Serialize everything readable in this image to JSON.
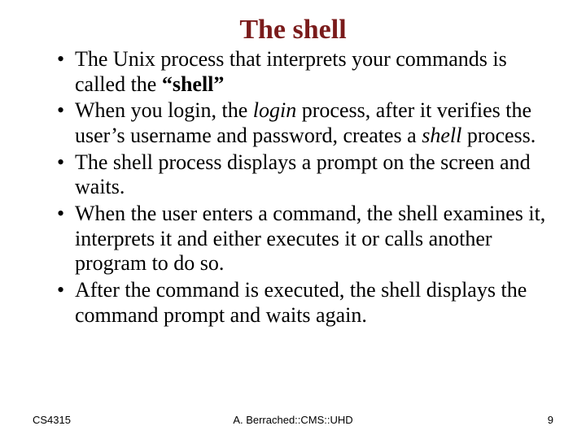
{
  "title": "The shell",
  "bullets": [
    {
      "prefix": "The Unix process that interprets your commands is called the ",
      "bold": "“shell”",
      "suffix": ""
    },
    {
      "prefix": "When you login, the ",
      "italic1": "login",
      "mid": " process, after it verifies the user’s username and password, creates a ",
      "italic2": "shell",
      "suffix": " process."
    },
    {
      "text": "The shell process displays a prompt on the screen and waits."
    },
    {
      "text": "When the user enters a command, the shell examines it, interprets it and either executes it or calls another program to do so."
    },
    {
      "text": "After the command is executed, the shell displays the command prompt and waits again."
    }
  ],
  "footer": {
    "left": "CS4315",
    "center": "A. Berrached::CMS::UHD",
    "right": "9"
  }
}
